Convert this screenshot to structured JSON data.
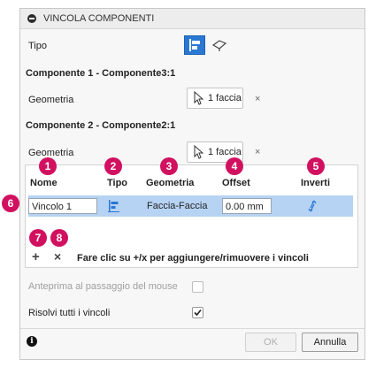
{
  "dialog": {
    "title": "VINCOLA COMPONENTI",
    "tipo_label": "Tipo",
    "component1_header": "Componente 1 - Componente3:1",
    "component1_geom_label": "Geometria",
    "component1_selection": "1 faccia",
    "component2_header": "Componente 2 - Componente2:1",
    "component2_geom_label": "Geometria",
    "component2_selection": "1 faccia",
    "remove_symbol": "×"
  },
  "table": {
    "headers": {
      "nome": "Nome",
      "tipo": "Tipo",
      "geometria": "Geometria",
      "offset": "Offset",
      "inverti": "Inverti"
    },
    "rows": [
      {
        "nome": "Vincolo 1",
        "geometria": "Faccia-Faccia",
        "offset": "0.00 mm"
      }
    ],
    "add_symbol": "+",
    "remove_symbol": "×",
    "hint": "Fare clic su +/x per aggiungere/rimuovere i vincoli"
  },
  "badges": [
    "1",
    "2",
    "3",
    "4",
    "5",
    "6",
    "7",
    "8"
  ],
  "options": {
    "preview_label": "Anteprima al passaggio del mouse",
    "preview_checked": false,
    "solve_all_label": "Risolvi tutti i vincoli",
    "solve_all_checked": true
  },
  "footer": {
    "info_symbol": "i",
    "ok_label": "OK",
    "cancel_label": "Annulla"
  },
  "colors": {
    "accent": "#2a78d3",
    "badge": "#d1115f",
    "row_selected": "#b6d3f3"
  }
}
